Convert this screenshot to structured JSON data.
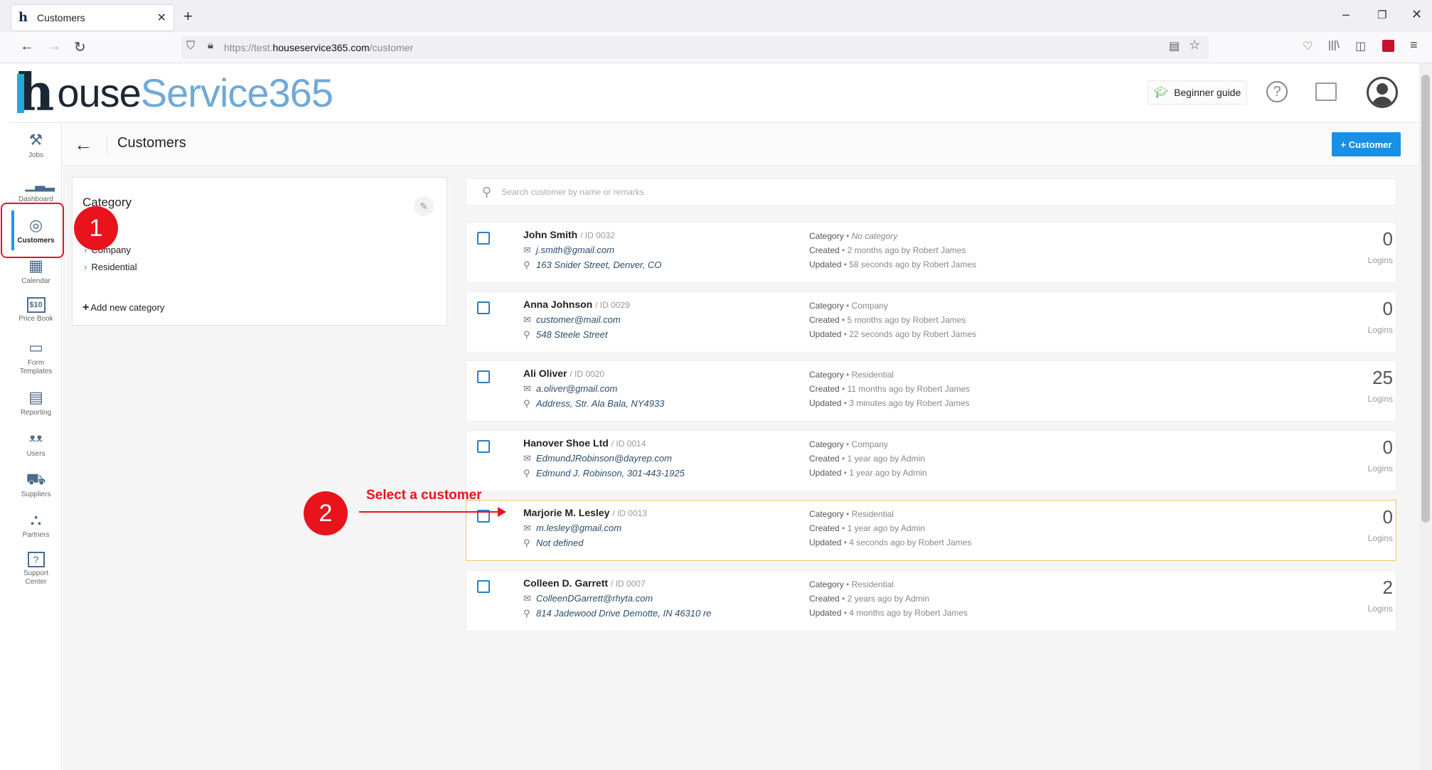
{
  "browser": {
    "tab_title": "Customers",
    "tab_close": "✕",
    "new_tab": "+",
    "url_prefix": "https://test.",
    "url_domain": "houseservice365.com",
    "url_path": "/customer",
    "window_controls": [
      "–",
      "❐",
      "✕"
    ]
  },
  "app": {
    "logo_part1": "ouse",
    "logo_part2": "Service365",
    "logo_h": "h",
    "beginner_guide": "Beginner guide",
    "help": "?"
  },
  "sidebar": {
    "items": [
      {
        "label": "Jobs",
        "icon": "tools-icon",
        "glyph": "⚒"
      },
      {
        "label": "Dashboard",
        "icon": "chart-icon",
        "glyph": "📊"
      },
      {
        "label": "Customers",
        "icon": "customers-icon",
        "glyph": "◎"
      },
      {
        "label": "Calendar",
        "icon": "calendar-icon",
        "glyph": "▦"
      },
      {
        "label": "Price Book",
        "icon": "pricebook-icon",
        "glyph": "$10"
      },
      {
        "label": "Form Templates",
        "icon": "form-icon",
        "glyph": "▭"
      },
      {
        "label": "Reporting",
        "icon": "report-icon",
        "glyph": "▤"
      },
      {
        "label": "Users",
        "icon": "users-icon",
        "glyph": "👥"
      },
      {
        "label": "Suppliers",
        "icon": "truck-icon",
        "glyph": "🚚"
      },
      {
        "label": "Partners",
        "icon": "partners-icon",
        "glyph": "⛬"
      },
      {
        "label": "Support Center",
        "icon": "support-icon",
        "glyph": "?"
      }
    ]
  },
  "page": {
    "title": "Customers",
    "add_button": "+ Customer",
    "search_placeholder": "Search customer by name or remarks"
  },
  "category": {
    "title": "Category",
    "items": [
      "Company",
      "Residential"
    ],
    "add": "Add new category"
  },
  "customers": [
    {
      "name": "John Smith",
      "id": "/ ID 0032",
      "email": "j.smith@gmail.com",
      "address": "163 Snider Street, Denver, CO",
      "category": "No category",
      "category_italic": true,
      "created": "2 months ago by Robert James",
      "updated": "58 seconds ago by Robert James",
      "logins": "0"
    },
    {
      "name": "Anna Johnson",
      "id": "/ ID 0029",
      "email": "customer@mail.com",
      "address": "548 Steele Street",
      "category": "Company",
      "category_italic": false,
      "created": "5 months ago by Robert James",
      "updated": "22 seconds ago by Robert James",
      "logins": "0"
    },
    {
      "name": "Ali Oliver",
      "id": "/ ID 0020",
      "email": "a.oliver@gmail.com",
      "address": "Address, Str. Ala Bala, NY4933",
      "category": "Residential",
      "category_italic": false,
      "created": "11 months ago by Robert James",
      "updated": "3 minutes ago by Robert James",
      "logins": "25"
    },
    {
      "name": "Hanover Shoe Ltd",
      "id": "/ ID 0014",
      "email": "EdmundJRobinson@dayrep.com",
      "address": "Edmund J. Robinson, 301-443-1925",
      "category": "Company",
      "category_italic": false,
      "created": "1 year ago by Admin",
      "updated": "1 year ago by Admin",
      "logins": "0"
    },
    {
      "name": "Marjorie M. Lesley",
      "id": "/ ID 0013",
      "email": "m.lesley@gmail.com",
      "address": "Not defined",
      "category": "Residential",
      "category_italic": false,
      "created": "1 year ago by Admin",
      "updated": "4 seconds ago by Robert James",
      "logins": "0"
    },
    {
      "name": "Colleen D. Garrett",
      "id": "/ ID 0007",
      "email": "ColleenDGarrett@rhyta.com",
      "address": "814 Jadewood Drive Demotte, IN 46310 re",
      "category": "Residential",
      "category_italic": false,
      "created": "2 years ago by Admin",
      "updated": "4 months ago by Robert James",
      "logins": "2"
    }
  ],
  "labels": {
    "category": "Category",
    "created": "Created",
    "updated": "Updated",
    "logins": "Logins",
    "dot": " • "
  },
  "annotations": {
    "step1": "1",
    "step2": "2",
    "step2_text": "Select a customer"
  },
  "colors": {
    "accent": "#1a8fe3",
    "annotation": "#e8131b",
    "selected_border": "#f0c36d"
  }
}
